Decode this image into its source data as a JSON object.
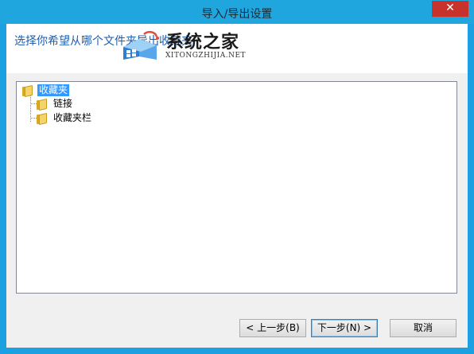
{
  "window": {
    "title": "导入/导出设置",
    "close_glyph": "✕"
  },
  "header": {
    "prompt": "选择你希望从哪个文件夹导出收藏夹"
  },
  "watermark": {
    "cn": "系统之家",
    "en": "XITONGZHIJIA.NET"
  },
  "tree": {
    "root": {
      "label": "收藏夹",
      "selected": true
    },
    "children": [
      {
        "label": "链接"
      },
      {
        "label": "收藏夹栏"
      }
    ]
  },
  "buttons": {
    "back": "< 上一步(B)",
    "next": "下一步(N) >",
    "cancel": "取消"
  },
  "colors": {
    "window_frame": "#1ba1e2",
    "close_button": "#c7332c",
    "prompt_text": "#1b5fae",
    "selection": "#3399ff"
  }
}
